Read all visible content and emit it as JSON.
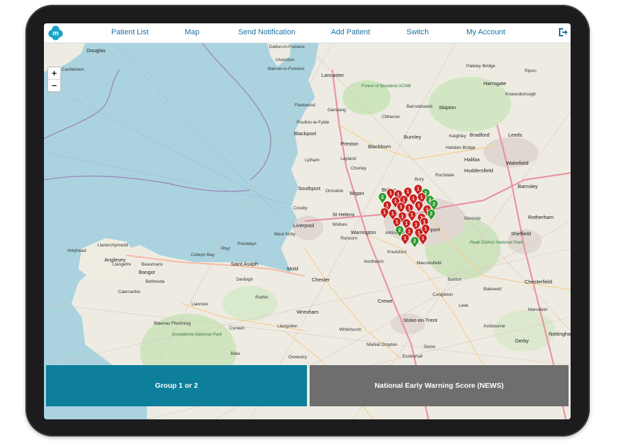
{
  "nav": {
    "items": [
      "Patient List",
      "Map",
      "Send Notification",
      "Add Patient",
      "Switch",
      "My Account"
    ],
    "logo_letter": "m"
  },
  "map": {
    "zoom_in": "+",
    "zoom_out": "−",
    "places": [
      "Douglas",
      "Castletown",
      "Dalton-in-Furness",
      "Ulverston",
      "Barrow-in-Furness",
      "Lancaster",
      "Forest of Bowland AONB",
      "Clitheroe",
      "Barnoldswick",
      "Skipton",
      "Ripon",
      "Pateley Bridge",
      "Knaresborough",
      "Harrogate",
      "Fleetwood",
      "Garstang",
      "Poulton-le-Fylde",
      "Blackpool",
      "Preston",
      "Blackburn",
      "Burnley",
      "Keighley",
      "Bradford",
      "Leeds",
      "Lytham",
      "Southport",
      "Leyland",
      "Chorley",
      "Bolton",
      "Bury",
      "Rochdale",
      "Halifax",
      "Huddersfield",
      "Wakefield",
      "Ormskirk",
      "Wigan",
      "St Helens",
      "Warrington",
      "Crosby",
      "Liverpool",
      "West Kirby",
      "Widnes",
      "Runcorn",
      "Altrincham",
      "Stockport",
      "Glossop",
      "Barnsley",
      "Holyhead",
      "Llanerchymedd",
      "Anglesey",
      "Llangefni",
      "Beaumaris",
      "Bangor",
      "Bethesda",
      "Caernarfon",
      "Colwyn Bay",
      "Rhyl",
      "Prestatyn",
      "Saint Asaph",
      "Denbigh",
      "Ruthin",
      "Mold",
      "Chester",
      "Northwich",
      "Knutsford",
      "Macclesfield",
      "Buxton",
      "Peak District National Park",
      "Sheffield",
      "Bakewell",
      "Chesterfield",
      "Crewe",
      "Congleton",
      "Leek",
      "Stoke-on-Trent",
      "Wrexham",
      "Llangollen",
      "Oswestry",
      "Whitchurch",
      "Market Drayton",
      "Stone",
      "Eccleshall",
      "Snowdonia National Park",
      "Blaenau Ffestiniog",
      "Bala",
      "Derby",
      "Nottingham",
      "Mansfield",
      "Llanrwst",
      "Corwen",
      "Hebden Bridge",
      "Rotherham",
      "Ashbourne"
    ]
  },
  "buttons": {
    "group": "Group 1 or 2",
    "news": "National Early Warning Score (NEWS)"
  },
  "markers": {
    "red_label": "1",
    "green_label": "2",
    "red_color": "#c8201e",
    "green_color": "#2e9a2e"
  },
  "colors": {
    "accent": "#0d7f9b",
    "nav_text": "#1b6fa0",
    "grey_button": "#6e6e6e"
  }
}
